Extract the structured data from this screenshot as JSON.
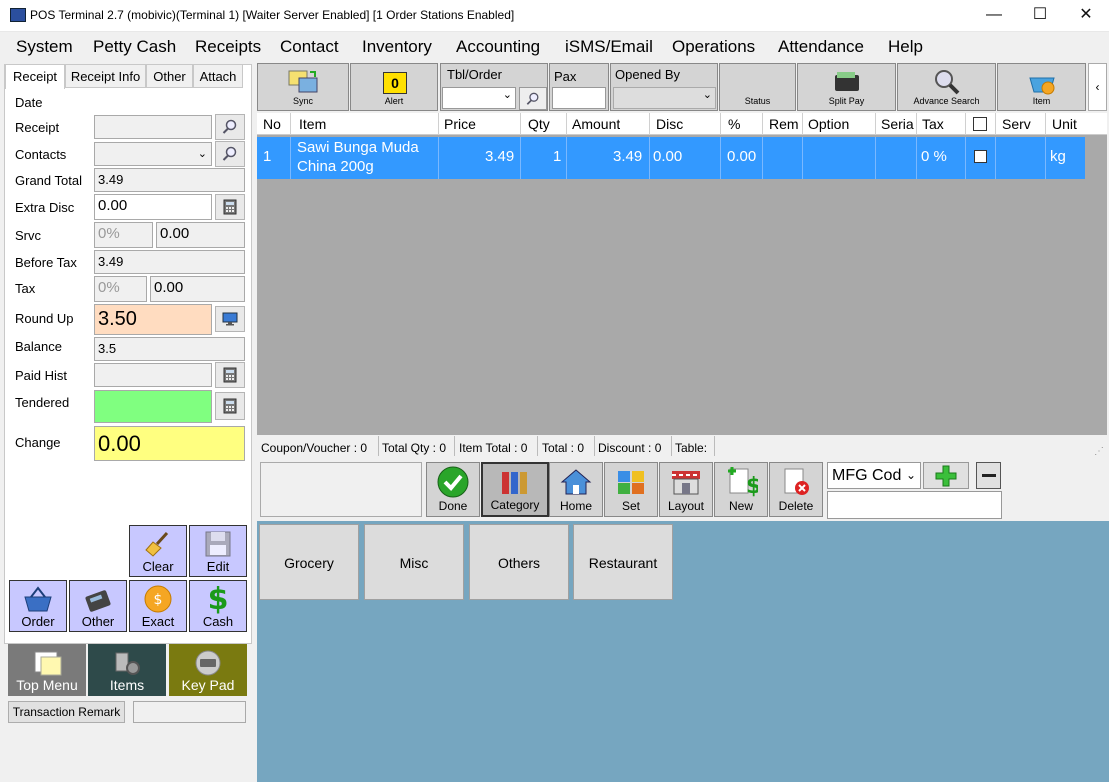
{
  "window": {
    "title": "POS Terminal 2.7 (mobivic)(Terminal 1) [Waiter Server Enabled] [1 Order Stations Enabled]",
    "minimize": "—",
    "maximize": "☐",
    "close": "✕"
  },
  "menu": [
    "System",
    "Petty Cash",
    "Receipts",
    "Contact",
    "Inventory",
    "Accounting",
    "iSMS/Email",
    "Operations",
    "Attendance",
    "Help"
  ],
  "left_tabs": [
    "Receipt",
    "Receipt Info",
    "Other",
    "Attach"
  ],
  "fields": {
    "date_label": "Date",
    "receipt_label": "Receipt",
    "contacts_label": "Contacts",
    "grand_total_label": "Grand Total",
    "grand_total": "3.49",
    "extra_disc_label": "Extra Disc",
    "extra_disc": "0.00",
    "srvc_label": "Srvc",
    "srvc_pct": "0%",
    "srvc_amt": "0.00",
    "before_tax_label": "Before Tax",
    "before_tax": "3.49",
    "tax_label": "Tax",
    "tax_pct": "0%",
    "tax_amt": "0.00",
    "round_up_label": "Round Up",
    "round_up": "3.50",
    "balance_label": "Balance",
    "balance": "3.5",
    "paid_hist_label": "Paid Hist",
    "tendered_label": "Tendered",
    "change_label": "Change",
    "change": "0.00"
  },
  "action_buttons": {
    "clear": "Clear",
    "edit": "Edit",
    "order": "Order",
    "other": "Other",
    "exact": "Exact",
    "cash": "Cash"
  },
  "bottom_buttons": {
    "top_menu": "Top Menu",
    "items": "Items",
    "key_pad": "Key Pad",
    "transaction_remark": "Transaction Remark"
  },
  "toolbar": {
    "sync": "Sync",
    "alert": "Alert",
    "alert_count": "0",
    "tbl_order": "Tbl/Order",
    "pax": "Pax",
    "opened_by": "Opened By",
    "status": "Status",
    "split_pay": "Split Pay",
    "advance_search": "Advance Search",
    "item": "Item",
    "scroll": "‹"
  },
  "grid": {
    "headers": [
      "No",
      "Item",
      "Price",
      "Qty",
      "Amount",
      "Disc",
      "%",
      "Rem",
      "Option",
      "Seria",
      "Tax",
      "",
      "Serv",
      "Unit"
    ],
    "rows": [
      {
        "no": "1",
        "item_line1": "Sawi Bunga Muda",
        "item_line2": "China 200g",
        "price": "3.49",
        "qty": "1",
        "amount": "3.49",
        "disc": "0.00",
        "pct": "0.00",
        "tax": "0 %",
        "unit": "kg"
      }
    ]
  },
  "statusbar": {
    "coupon": "Coupon/Voucher :  0",
    "total_qty": "Total Qty :  0",
    "item_total": "Item Total :  0",
    "total": "Total :  0",
    "discount": "Discount :  0",
    "table": "Table:"
  },
  "categories": {
    "done": "Done",
    "category": "Category",
    "home": "Home",
    "set": "Set",
    "layout": "Layout",
    "new": "New",
    "delete": "Delete"
  },
  "mfg_select": "MFG Cod",
  "groups": [
    "Grocery",
    "Misc",
    "Others",
    "Restaurant"
  ],
  "colors": {
    "accent": "#3399ff",
    "round_up_bg": "#ffdcc0",
    "tendered_bg": "#80ff80",
    "change_bg": "#ffff80",
    "group_bg": "#76a6c0",
    "action_bg": "#c8c8ff"
  }
}
